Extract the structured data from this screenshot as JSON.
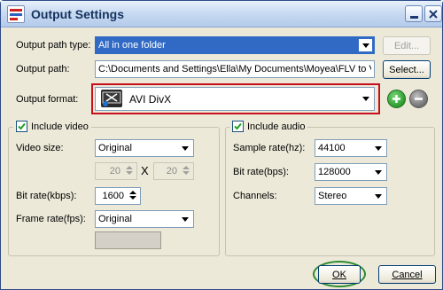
{
  "window": {
    "title": "Output Settings"
  },
  "titlebar": {
    "minimize_icon": "minimize-icon",
    "close_icon": "close-icon"
  },
  "output_path_type": {
    "label": "Output path type:",
    "value": "All in one folder",
    "edit_button": "Edit..."
  },
  "output_path": {
    "label": "Output path:",
    "value": "C:\\Documents and Settings\\Ella\\My Documents\\Moyea\\FLV to Videc",
    "select_button": "Select..."
  },
  "output_format": {
    "label": "Output format:",
    "value": "AVI DivX",
    "add_icon": "plus-icon",
    "remove_icon": "minus-icon"
  },
  "video": {
    "include_label": "Include video",
    "checked": true,
    "size_label": "Video size:",
    "size_value": "Original",
    "width": "20",
    "height": "20",
    "x_sep": "X",
    "bitrate_label": "Bit rate(kbps):",
    "bitrate_value": "1600",
    "framerate_label": "Frame rate(fps):",
    "framerate_value": "Original"
  },
  "audio": {
    "include_label": "Include audio",
    "checked": true,
    "samplerate_label": "Sample rate(hz):",
    "samplerate_value": "44100",
    "bitrate_label": "Bit rate(bps):",
    "bitrate_value": "128000",
    "channels_label": "Channels:",
    "channels_value": "Stereo"
  },
  "footer": {
    "ok_label": "OK",
    "cancel_label": "Cancel"
  },
  "colors": {
    "highlight_red": "#c8101c",
    "highlight_green": "#2e8b2e",
    "add_green": "#2c9a2c",
    "remove_gray": "#808080",
    "selection_blue": "#316ac5"
  }
}
